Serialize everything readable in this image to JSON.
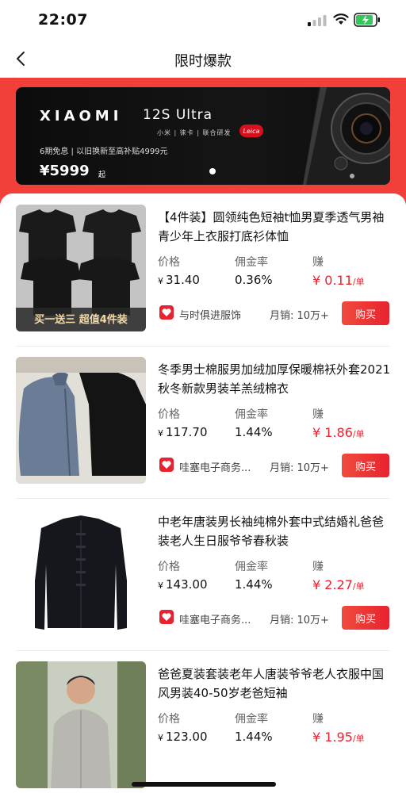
{
  "status_bar": {
    "time": "22:07"
  },
  "nav": {
    "title": "限时爆款"
  },
  "banner": {
    "brand": "XIAOMI",
    "model": "12S Ultra",
    "collab": "小米 | 徕卡 | 联合研发",
    "leica": "Leica",
    "promo": "6期免息 | 以旧换新至高补贴4999元",
    "price": "¥5999",
    "price_suffix": "起"
  },
  "labels": {
    "price": "价格",
    "commission": "佣金率",
    "earn": "赚",
    "per_unit": "/单",
    "currency": "¥",
    "buy": "购买"
  },
  "products": [
    {
      "title": "【4件装】圆领纯色短袖t恤男夏季透气男袖青少年上衣服打底衫体恤",
      "image_caption": "买一送三 超值4件装",
      "price": "31.40",
      "commission": "0.36%",
      "earn": "¥ 0.11",
      "shop": "与时俱进服饰",
      "sales": "月销: 10万+"
    },
    {
      "title": "冬季男士棉服男加绒加厚保暖棉袄外套2021秋冬新款男装羊羔绒棉衣",
      "price": "117.70",
      "commission": "1.44%",
      "earn": "¥ 1.86",
      "shop": "哇塞电子商务...",
      "sales": "月销: 10万+"
    },
    {
      "title": "中老年唐装男长袖纯棉外套中式结婚礼爸爸装老人生日服爷爷春秋装",
      "price": "143.00",
      "commission": "1.44%",
      "earn": "¥ 2.27",
      "shop": "哇塞电子商务...",
      "sales": "月销: 10万+"
    },
    {
      "title": "爸爸夏装套装老年人唐装爷爷老人衣服中国风男装40-50岁老爸短袖",
      "price": "123.00",
      "commission": "1.44%",
      "earn": "¥ 1.95"
    }
  ]
}
